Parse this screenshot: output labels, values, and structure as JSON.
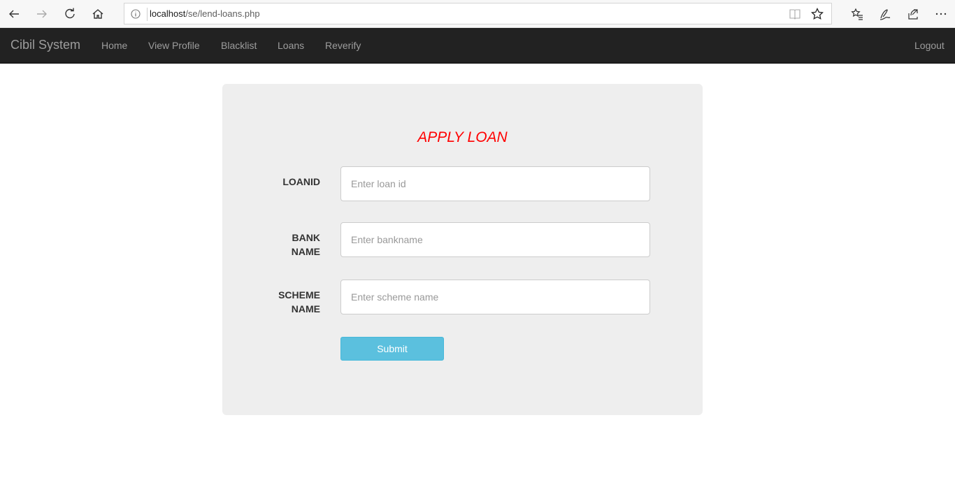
{
  "browser": {
    "url_host": "localhost",
    "url_path": "/se/lend-loans.php",
    "icons": [
      "back-icon",
      "forward-icon",
      "refresh-icon",
      "home-icon",
      "info-icon",
      "reading-view-icon",
      "favorite-star-icon",
      "favorites-list-icon",
      "pen-icon",
      "share-icon",
      "more-icon"
    ]
  },
  "navbar": {
    "brand": "Cibil System",
    "links": [
      "Home",
      "View Profile",
      "Blacklist",
      "Loans",
      "Reverify"
    ],
    "logout": "Logout",
    "bg_color": "#222222",
    "link_color": "#9d9d9d"
  },
  "form": {
    "title": "APPLY LOAN",
    "title_color": "#ff0000",
    "fields": [
      {
        "label": "LOANID",
        "placeholder": "Enter loan id",
        "value": ""
      },
      {
        "label": "BANK\nNAME",
        "placeholder": "Enter bankname",
        "value": ""
      },
      {
        "label": "SCHEME\nNAME",
        "placeholder": "Enter scheme name",
        "value": ""
      }
    ],
    "submit_label": "Submit",
    "submit_color": "#5bc0de"
  }
}
